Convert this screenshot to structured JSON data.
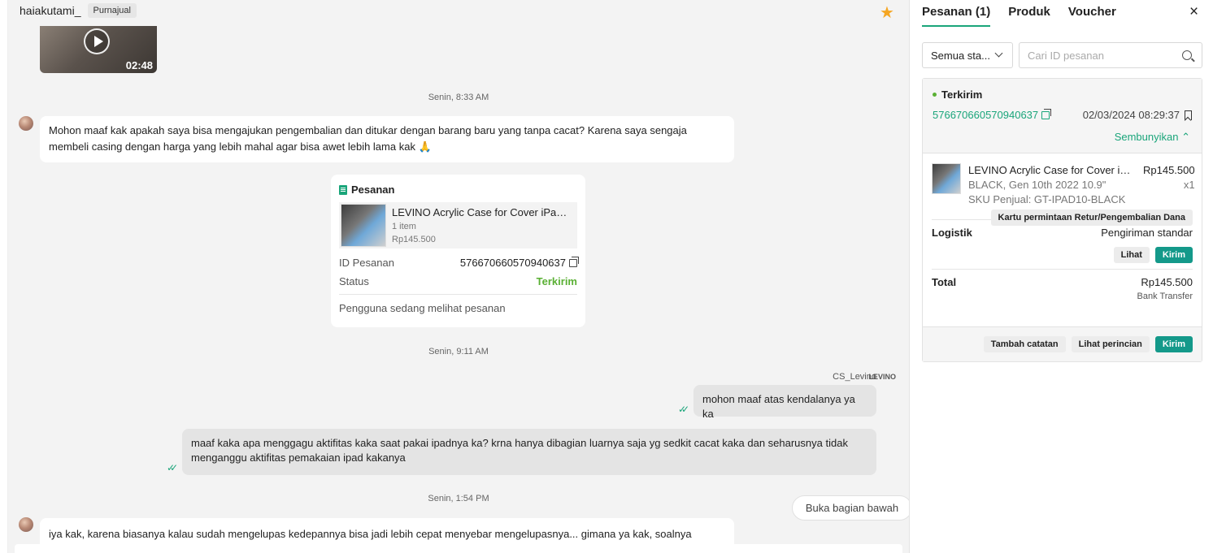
{
  "chat": {
    "username": "haiakutami_",
    "badge": "Purnajual",
    "video": {
      "duration": "02:48"
    },
    "timestamps": [
      "Senin, 8:33 AM",
      "Senin, 9:11 AM",
      "Senin, 1:54 PM"
    ],
    "messages": {
      "msg1": "Mohon maaf kak apakah saya bisa mengajukan pengembalian dan ditukar dengan barang baru yang tanpa cacat? Karena saya sengaja membeli casing dengan harga yang lebih mahal agar bisa awet lebih lama kak 🙏",
      "agent_name": "CS_Levino",
      "agent_logo": "LEVINO",
      "msg2": "mohon maaf atas kendalanya ya ka",
      "msg3": "maaf kaka apa menggagu aktifitas kaka saat pakai ipadnya ka? krna hanya dibagian luarnya saja yg sedkit cacat kaka dan seharusnya tidak menganggu aktifitas pemakaian ipad kakanya",
      "msg4": "iya kak, karena biasanya kalau sudah mengelupas kedepannya bisa jadi lebih cepat menyebar mengelupasnya... gimana ya kak, soalnya harapan"
    },
    "order_card": {
      "title": "Pesanan",
      "product_name": "LEVINO Acrylic Case for Cover iPad i...",
      "item_count": "1 item",
      "price": "Rp145.500",
      "id_label": "ID Pesanan",
      "id_value": "576670660570940637",
      "status_label": "Status",
      "status_value": "Terkirim",
      "footer": "Pengguna sedang melihat pesanan"
    },
    "open_bottom": "Buka bagian bawah"
  },
  "panel": {
    "tabs": [
      "Pesanan (1)",
      "Produk",
      "Voucher"
    ],
    "filter": "Semua sta...",
    "search_placeholder": "Cari ID pesanan",
    "order": {
      "status": "Terkirim",
      "id": "576670660570940637",
      "date": "02/03/2024 08:29:37",
      "hide": "Sembunyikan",
      "product_name": "LEVINO Acrylic Case for Cover iPa...",
      "variant": "BLACK, Gen 10th 2022 10.9\"",
      "sku": "SKU Penjual: GT-IPAD10-BLACK",
      "price": "Rp145.500",
      "qty": "x1",
      "return_btn": "Kartu permintaan Retur/Pengembalian Dana",
      "logistics_label": "Logistik",
      "logistics_value": "Pengiriman standar",
      "view_btn": "Lihat",
      "send_btn": "Kirim",
      "total_label": "Total",
      "total_value": "Rp145.500",
      "payment": "Bank Transfer",
      "add_note": "Tambah catatan",
      "view_detail": "Lihat perincian",
      "send_btn2": "Kirim"
    }
  },
  "colors": {
    "accent": "#1aa57a",
    "button_teal": "#14998a",
    "status_green": "#5ab034",
    "star": "#f5a623"
  }
}
